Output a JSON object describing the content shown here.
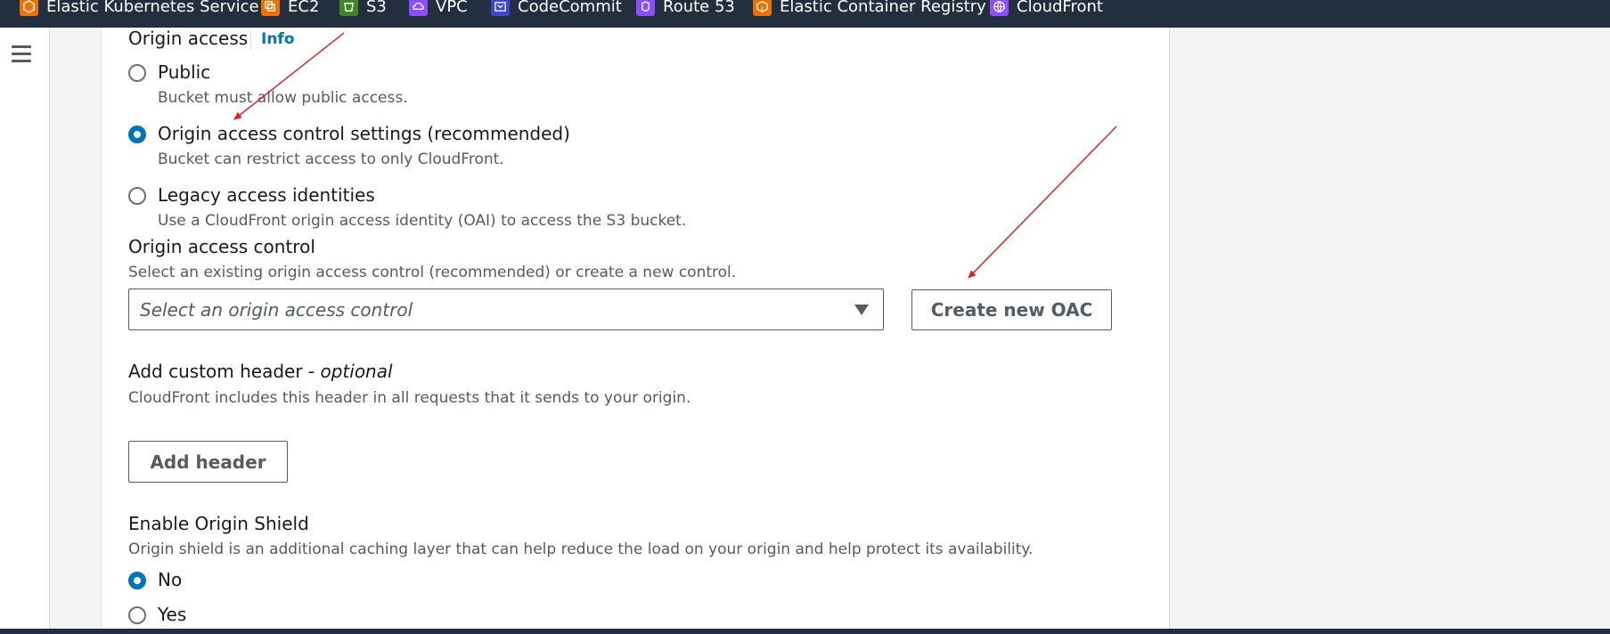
{
  "favorites": [
    {
      "label": "Elastic Kubernetes Service",
      "icon": "eks-icon",
      "color": "#ed7100"
    },
    {
      "label": "EC2",
      "icon": "ec2-icon",
      "color": "#ed7100"
    },
    {
      "label": "S3",
      "icon": "s3-icon",
      "color": "#3f8624"
    },
    {
      "label": "VPC",
      "icon": "vpc-icon",
      "color": "#8c4fff"
    },
    {
      "label": "CodeCommit",
      "icon": "codecommit-icon",
      "color": "#3b48cc"
    },
    {
      "label": "Route 53",
      "icon": "route53-icon",
      "color": "#8c4fff"
    },
    {
      "label": "Elastic Container Registry",
      "icon": "ecr-icon",
      "color": "#ed7100"
    },
    {
      "label": "CloudFront",
      "icon": "cloudfront-icon",
      "color": "#8c4fff"
    }
  ],
  "origin_access": {
    "title": "Origin access",
    "info": "Info",
    "options": [
      {
        "label": "Public",
        "description": "Bucket must allow public access.",
        "selected": false
      },
      {
        "label": "Origin access control settings (recommended)",
        "description": "Bucket can restrict access to only CloudFront.",
        "selected": true
      },
      {
        "label": "Legacy access identities",
        "description": "Use a CloudFront origin access identity (OAI) to access the S3 bucket.",
        "selected": false
      }
    ]
  },
  "origin_access_control": {
    "title": "Origin access control",
    "description": "Select an existing origin access control (recommended) or create a new control.",
    "placeholder": "Select an origin access control",
    "create_button": "Create new OAC"
  },
  "custom_header": {
    "title": "Add custom header - ",
    "optional": "optional",
    "description": "CloudFront includes this header in all requests that it sends to your origin.",
    "button": "Add header"
  },
  "origin_shield": {
    "title": "Enable Origin Shield",
    "description": "Origin shield is an additional caching layer that can help reduce the load on your origin and help protect its availability.",
    "options": [
      {
        "label": "No",
        "selected": true
      },
      {
        "label": "Yes",
        "selected": false
      }
    ]
  },
  "colors": {
    "accent": "#0073bb",
    "annotation": "#e02020",
    "header_bg": "#232f3e"
  }
}
